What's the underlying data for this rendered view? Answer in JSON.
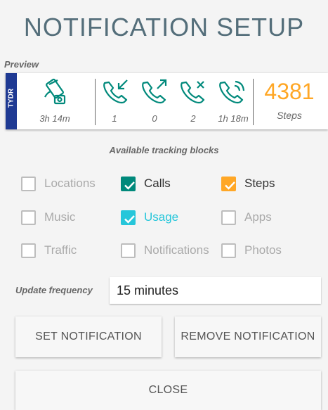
{
  "title": "NOTIFICATION SETUP",
  "preview": {
    "label": "Preview",
    "brand": "TYDR",
    "screen_time": "3h 14m",
    "missed_calls": "1",
    "outgoing_calls": "0",
    "rejected_calls": "2",
    "call_duration": "1h 18m",
    "steps_value": "4381",
    "steps_label": "Steps",
    "icons": [
      "phone-screen-icon",
      "incoming-call-icon",
      "outgoing-call-icon",
      "missed-call-icon",
      "call-duration-icon"
    ],
    "colors": {
      "call_icon": "#00897b",
      "steps": "#ffa726",
      "brand": "#1f3a93"
    }
  },
  "blocks": {
    "heading": "Available tracking blocks",
    "items": [
      {
        "label": "Locations",
        "checked": false
      },
      {
        "label": "Calls",
        "checked": true,
        "color": "#00897b"
      },
      {
        "label": "Steps",
        "checked": true,
        "color": "#ffa726"
      },
      {
        "label": "Music",
        "checked": false
      },
      {
        "label": "Usage",
        "checked": true,
        "color": "#26c6da"
      },
      {
        "label": "Apps",
        "checked": false
      },
      {
        "label": "Traffic",
        "checked": false
      },
      {
        "label": "Notifications",
        "checked": false
      },
      {
        "label": "Photos",
        "checked": false
      }
    ]
  },
  "update": {
    "label": "Update frequency",
    "value": "15 minutes"
  },
  "buttons": {
    "set": "SET NOTIFICATION",
    "remove": "REMOVE NOTIFICATION",
    "close": "CLOSE"
  }
}
